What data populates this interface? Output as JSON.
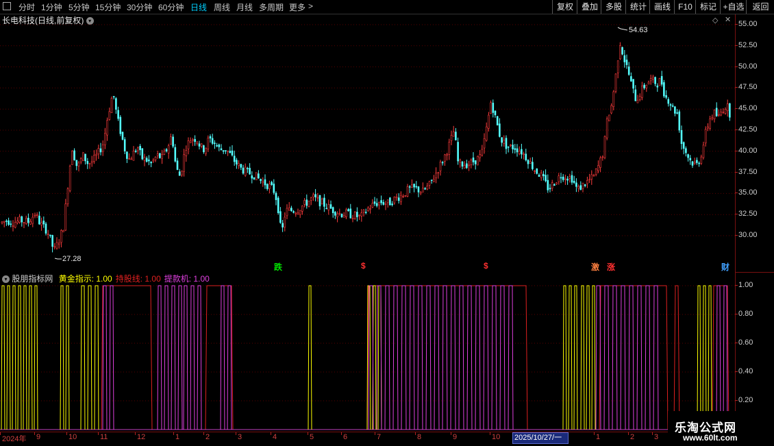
{
  "toolbar": {
    "periods": [
      {
        "label": "分时",
        "active": false
      },
      {
        "label": "1分钟",
        "active": false
      },
      {
        "label": "5分钟",
        "active": false
      },
      {
        "label": "15分钟",
        "active": false
      },
      {
        "label": "30分钟",
        "active": false
      },
      {
        "label": "60分钟",
        "active": false
      },
      {
        "label": "日线",
        "active": true
      },
      {
        "label": "周线",
        "active": false
      },
      {
        "label": "月线",
        "active": false
      },
      {
        "label": "多周期",
        "active": false
      },
      {
        "label": "更多",
        "active": false
      }
    ],
    "actions": [
      "复权",
      "叠加",
      "多股",
      "统计",
      "画线",
      "F10",
      "标记",
      "+自选",
      "返回"
    ]
  },
  "price_panel": {
    "title": "长电科技(日线,前复权)",
    "high_label": "54.63",
    "low_label": "27.28",
    "y_labels": [
      "55.00",
      "52.50",
      "50.00",
      "47.50",
      "45.00",
      "42.50",
      "40.00",
      "37.50",
      "35.00",
      "32.50",
      "30.00"
    ],
    "signals": [
      {
        "text": "跌",
        "color": "#00e000"
      },
      {
        "text": "$",
        "color": "#ff3030"
      },
      {
        "text": "$",
        "color": "#ff3030"
      },
      {
        "text": "激",
        "color": "#ff8040"
      },
      {
        "text": "涨",
        "color": "#ff3030"
      },
      {
        "text": "财",
        "color": "#40a0ff"
      }
    ]
  },
  "indicator_panel": {
    "name": "股朋指标网",
    "lines": [
      {
        "label": "黄金指示: 1.00",
        "color": "#ffff00"
      },
      {
        "label": "持股线: 1.00",
        "color": "#e02020"
      },
      {
        "label": "提款机: 1.00",
        "color": "#e040e0"
      }
    ],
    "y_labels": [
      "1.00",
      "0.80",
      "0.60",
      "0.40",
      "0.20"
    ]
  },
  "bottom_axis": {
    "labels": [
      "2024年",
      "9",
      "10",
      "11",
      "12",
      "1",
      "2",
      "3",
      "4",
      "5",
      "6",
      "7",
      "8",
      "9",
      "10",
      "1",
      "2",
      "3"
    ],
    "date_box": "2025/10/27/一"
  },
  "watermark": {
    "name": "乐淘公式网",
    "url": "www.60lt.com"
  },
  "colors": {
    "up": "#ff3c3c",
    "down": "#54ffff",
    "grid": "#5a0000"
  }
}
